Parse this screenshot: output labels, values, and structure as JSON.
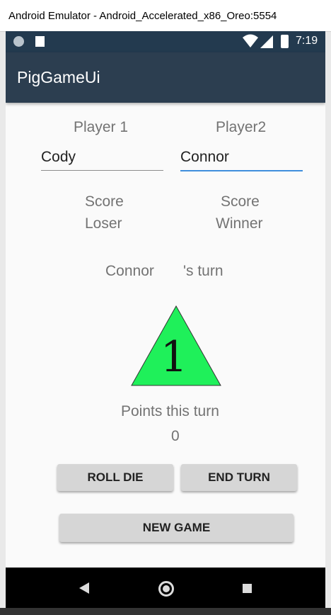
{
  "window": {
    "title": "Android Emulator - Android_Accelerated_x86_Oreo:5554"
  },
  "status_bar": {
    "time": "7:19"
  },
  "app_bar": {
    "title": "PigGameUi"
  },
  "players": [
    {
      "label": "Player 1",
      "name": "Cody",
      "score_label": "Score",
      "status": "Loser"
    },
    {
      "label": "Player2",
      "name": "Connor",
      "score_label": "Score",
      "status": "Winner"
    }
  ],
  "turn": {
    "current_player": "Connor",
    "suffix": "'s turn"
  },
  "die": {
    "value": "1",
    "color": "#1ff05a"
  },
  "points": {
    "label": "Points this turn",
    "value": "0"
  },
  "buttons": {
    "roll": "ROLL DIE",
    "end_turn": "END TURN",
    "new_game": "NEW GAME"
  },
  "colors": {
    "app_bar": "#2c3e50",
    "status_bar": "#233a4f",
    "accent": "#3f8edc"
  }
}
